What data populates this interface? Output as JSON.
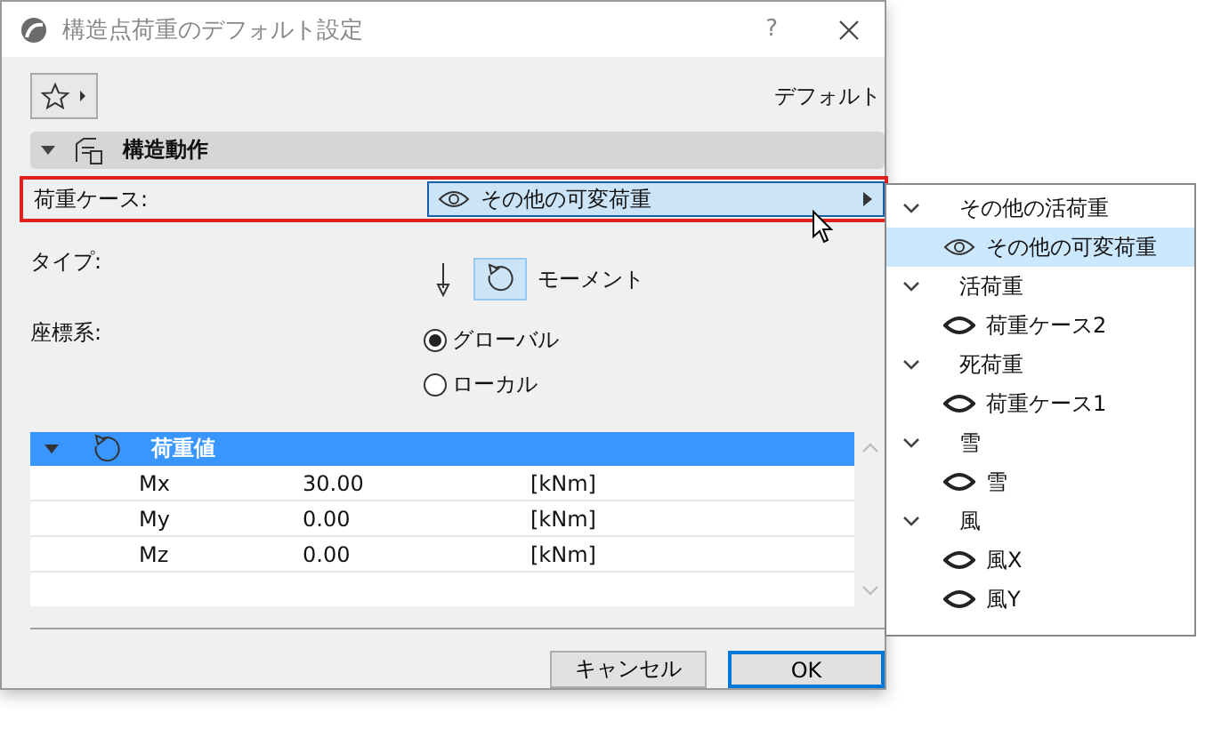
{
  "window": {
    "title": "構造点荷重のデフォルト設定",
    "help": "?"
  },
  "favorites": {
    "label": "デフォルト"
  },
  "section": {
    "title": "構造動作",
    "expanded": true
  },
  "load_case": {
    "label": "荷重ケース:",
    "value": "その他の可変荷重",
    "highlighted": true
  },
  "type": {
    "label": "タイプ:",
    "options": [
      {
        "kind": "force",
        "selected": false
      },
      {
        "kind": "moment",
        "selected": true
      }
    ],
    "value_label": "モーメント"
  },
  "coordinate_system": {
    "label": "座標系:",
    "options": [
      {
        "label": "グローバル",
        "selected": true
      },
      {
        "label": "ローカル",
        "selected": false
      }
    ]
  },
  "load_values": {
    "title": "荷重値",
    "expanded": true,
    "rows": [
      {
        "name": "Mx",
        "value": "30.00",
        "unit": "[kNm]"
      },
      {
        "name": "My",
        "value": "0.00",
        "unit": "[kNm]"
      },
      {
        "name": "Mz",
        "value": "0.00",
        "unit": "[kNm]"
      }
    ]
  },
  "buttons": [
    {
      "label": "キャンセル",
      "default": false
    },
    {
      "label": "OK",
      "default": true
    }
  ],
  "dropdown": {
    "groups": [
      {
        "name": "その他の活荷重",
        "expanded": true,
        "items": [
          {
            "label": "その他の可変荷重",
            "selected": true
          }
        ]
      },
      {
        "name": "活荷重",
        "expanded": true,
        "items": [
          {
            "label": "荷重ケース2",
            "selected": false
          }
        ]
      },
      {
        "name": "死荷重",
        "expanded": true,
        "items": [
          {
            "label": "荷重ケース1",
            "selected": false
          }
        ]
      },
      {
        "name": "雪",
        "expanded": true,
        "items": [
          {
            "label": "雪",
            "selected": false
          }
        ]
      },
      {
        "name": "風",
        "expanded": true,
        "items": [
          {
            "label": "風X",
            "selected": false
          },
          {
            "label": "風Y",
            "selected": false
          }
        ]
      }
    ]
  }
}
